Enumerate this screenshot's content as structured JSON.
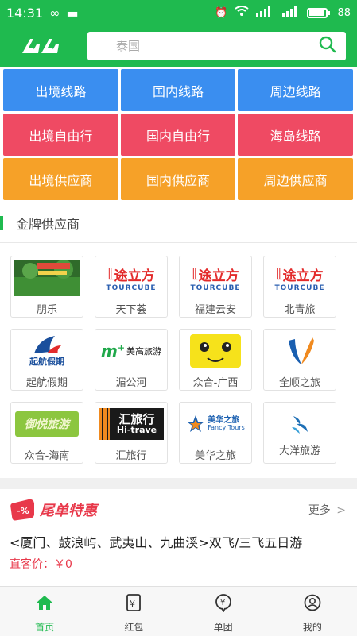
{
  "status": {
    "time": "14:31",
    "battery": "88"
  },
  "header": {
    "search_placeholder": "泰国"
  },
  "routes": [
    {
      "label": "出境线路",
      "color": "#3a8ef0"
    },
    {
      "label": "国内线路",
      "color": "#3a8ef0"
    },
    {
      "label": "周边线路",
      "color": "#3a8ef0"
    },
    {
      "label": "出境自由行",
      "color": "#ef4a63"
    },
    {
      "label": "国内自由行",
      "color": "#ef4a63"
    },
    {
      "label": "海岛线路",
      "color": "#ef4a63"
    },
    {
      "label": "出境供应商",
      "color": "#f6a128"
    },
    {
      "label": "国内供应商",
      "color": "#f6a128"
    },
    {
      "label": "周边供应商",
      "color": "#f6a128"
    }
  ],
  "gold": {
    "title": "金牌供应商",
    "suppliers": [
      {
        "name": "朋乐",
        "logo": "朋乐-logo"
      },
      {
        "name": "天下荟",
        "logo": "tourcube-logo",
        "logo_text": "途立方",
        "logo_sub": "TOURCUBE"
      },
      {
        "name": "福建云安",
        "logo": "tourcube-logo",
        "logo_text": "途立方",
        "logo_sub": "TOURCUBE"
      },
      {
        "name": "北青旅",
        "logo": "tourcube-logo",
        "logo_text": "途立方",
        "logo_sub": "TOURCUBE"
      },
      {
        "name": "起航假期",
        "logo": "qihang-logo",
        "logo_text": "起航假期"
      },
      {
        "name": "湄公河",
        "logo": "meigao-logo",
        "logo_text": "美高旅游"
      },
      {
        "name": "众合-广西",
        "logo": "smiley-logo"
      },
      {
        "name": "全顺之旅",
        "logo": "quanshun-logo"
      },
      {
        "name": "众合-海南",
        "logo": "yuyue-logo",
        "logo_text": "御悦旅游"
      },
      {
        "name": "汇旅行",
        "logo": "hitravel-logo",
        "logo_text": "汇旅行",
        "logo_sub": "Hi-trave"
      },
      {
        "name": "美华之旅",
        "logo": "fancy-logo",
        "logo_text": "美华之旅",
        "logo_sub": "Fancy Tours"
      },
      {
        "name": "大洋旅游",
        "logo": "dayang-logo",
        "logo_text": "大洋旅游"
      }
    ]
  },
  "special": {
    "title": "尾单特惠",
    "badge": "-%",
    "more": "更多",
    "deal_title": "<厦门、鼓浪屿、武夷山、九曲溪>双飞/三飞五日游",
    "deal_price": "直客价：￥0"
  },
  "tabs": [
    {
      "label": "首页",
      "icon": "home-icon",
      "active": true
    },
    {
      "label": "红包",
      "icon": "red-packet-icon",
      "active": false
    },
    {
      "label": "单团",
      "icon": "group-icon",
      "active": false
    },
    {
      "label": "我的",
      "icon": "user-icon",
      "active": false
    }
  ],
  "colors": {
    "brand": "#1fba4f",
    "blue": "#3a8ef0",
    "red": "#ef4a63",
    "orange": "#f6a128"
  }
}
